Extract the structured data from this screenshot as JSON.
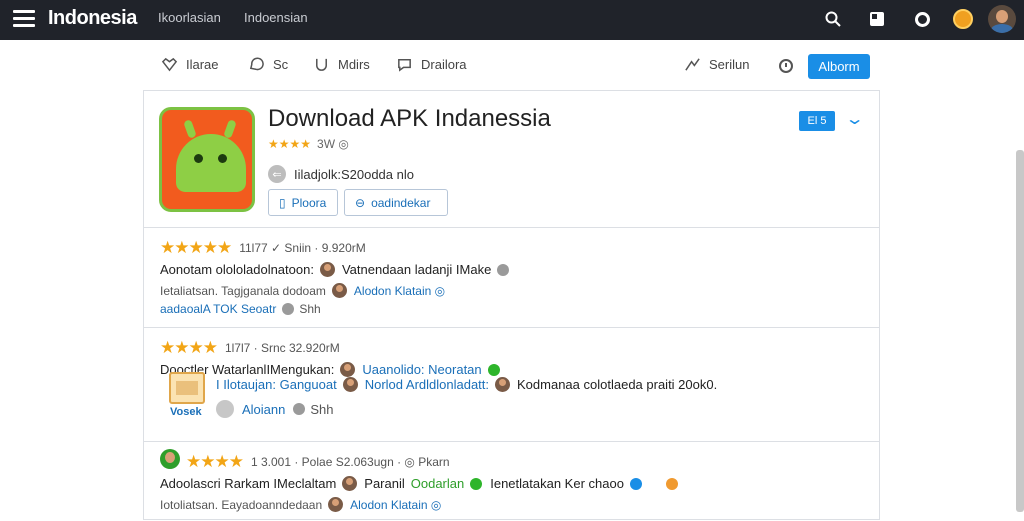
{
  "topbar": {
    "brand": "Indonesia",
    "nav": [
      "Ikoorlasian",
      "Indoensian"
    ],
    "icons": [
      "search-icon",
      "grid-icon",
      "ring-icon",
      "coin-icon",
      "avatar"
    ]
  },
  "subnav": {
    "items": [
      {
        "label": "Ilarae",
        "icon": "heart-icon"
      },
      {
        "label": "Sc",
        "icon": "chat-icon"
      },
      {
        "label": "Mdirs",
        "icon": "shield-icon"
      },
      {
        "label": "Drailora",
        "icon": "comment-icon"
      },
      {
        "label": "Serilun",
        "icon": "share-icon"
      }
    ],
    "button": "Alborm"
  },
  "app": {
    "title": "Download APK  Indanessia",
    "rating_stars": "★★★★",
    "rating_text": "3W  ◎",
    "meta_icon": "⇐",
    "meta": "Iiladjolk:S20odda nlo",
    "btn1": "Ploora",
    "btn2": "oadindekar",
    "tag": "El 5",
    "chevron": "⌄"
  },
  "reviews": [
    {
      "stars": "★★★★★",
      "head": "11l77 ✓ Sniin · 9.920rM",
      "lines": [
        [
          "Aonotam olololadolnatoon:",
          "Vatnendaan ladanji IMake"
        ],
        [
          "Ietaliatsan. Tagjganala dodoam",
          "Alodon Klatain ◎"
        ],
        [
          "aadaoalA TOK Seoatr",
          "Shh"
        ]
      ]
    },
    {
      "stars": "★★★★",
      "head": "1l7l7 · Srnc 32.920rM",
      "lines": [
        [
          "Dooctler WatarlanlIMengukan:",
          "Uaanolido: Neoratan"
        ],
        [
          "I Ilotaujan: Ganguoat",
          "Norlod Ardldlonladatt:",
          "Kodmanaa colotlaeda praiti 20ok0."
        ],
        [
          "Aloiann",
          "Shh"
        ]
      ],
      "voucher": "Vosek"
    },
    {
      "stars": "★★★★",
      "head": "1 3.001 · Polae S2.063ugn · ◎ Pkarn",
      "lines": [
        [
          "Adoolascri Rarkam IMeclaltam",
          "Paranil",
          "Oodarlan",
          "Ienetlatakan Ker chaoo"
        ],
        [
          "Iotoliatsan. Eayadoanndedaan",
          "Alodon Klatain ◎"
        ]
      ]
    }
  ]
}
